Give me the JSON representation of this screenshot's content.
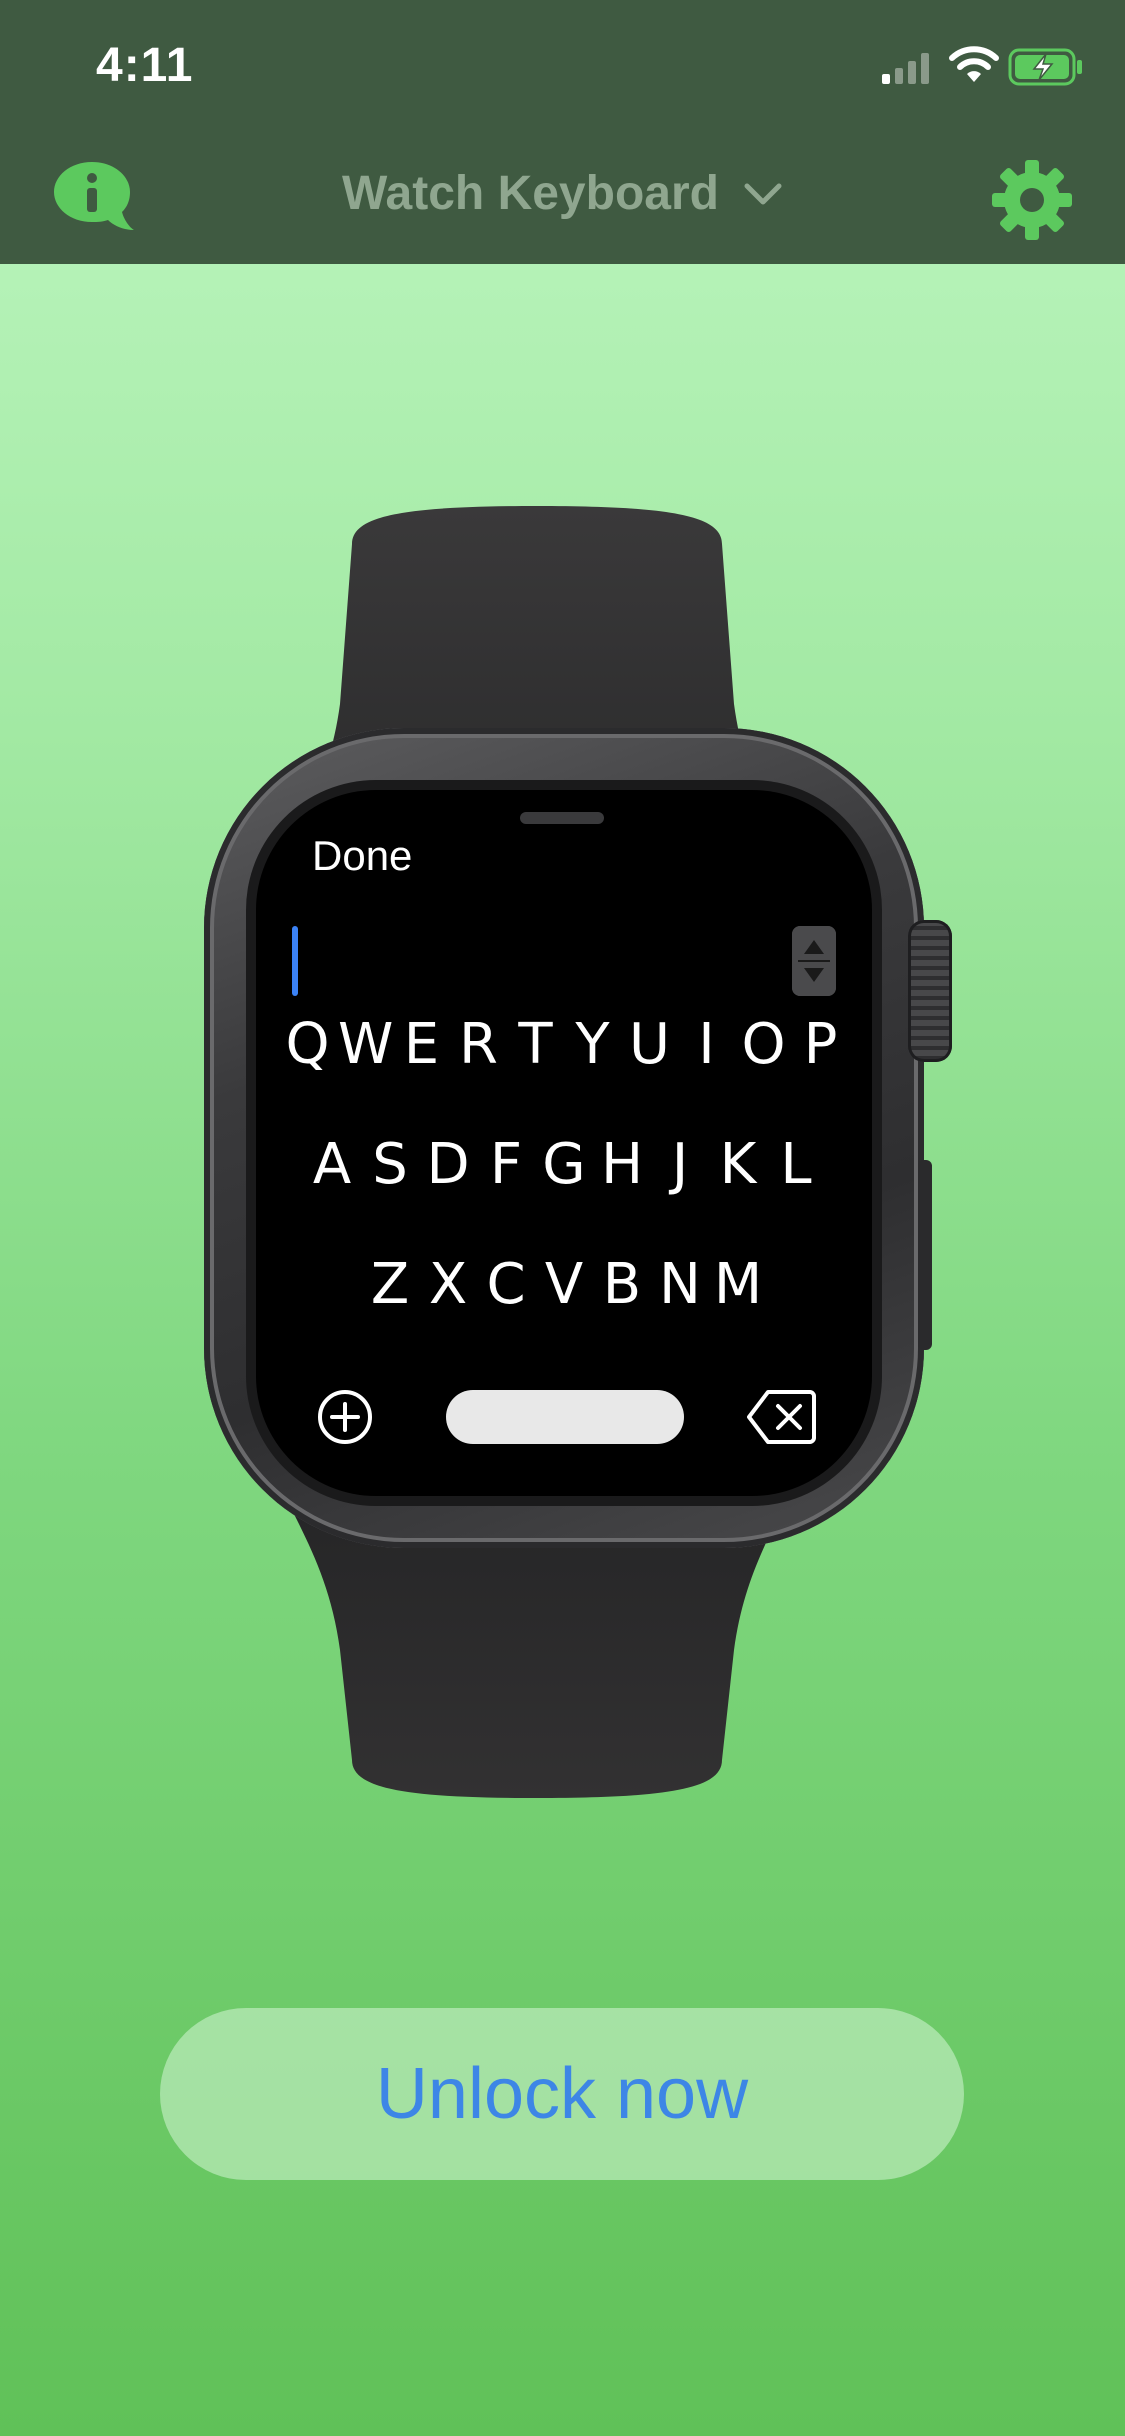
{
  "status_bar": {
    "time": "4:11",
    "signal_icon": "cellular-signal-icon",
    "wifi_icon": "wifi-icon",
    "battery_icon": "battery-charging-icon"
  },
  "nav": {
    "title": "Watch Keyboard",
    "info_icon": "info-bubble-icon",
    "chevron_icon": "chevron-down-icon",
    "settings_icon": "gear-icon"
  },
  "watch_screen": {
    "done_label": "Done",
    "keyboard_rows": [
      [
        "Q",
        "W",
        "E",
        "R",
        "T",
        "Y",
        "U",
        "I",
        "O",
        "P"
      ],
      [
        "A",
        "S",
        "D",
        "F",
        "G",
        "H",
        "J",
        "K",
        "L"
      ],
      [
        "Z",
        "X",
        "C",
        "V",
        "B",
        "N",
        "M"
      ]
    ],
    "plus_icon": "plus-circle-icon",
    "space_label": "",
    "delete_icon": "delete-backspace-icon",
    "stepper_icon": "up-down-stepper-icon"
  },
  "cta": {
    "label": "Unlock now"
  },
  "colors": {
    "topbar": "#3f5a41",
    "accent_green": "#5cc95e",
    "title_gray": "#8fa68f",
    "link_blue": "#3d86e6",
    "cursor_blue": "#3b82f6"
  }
}
